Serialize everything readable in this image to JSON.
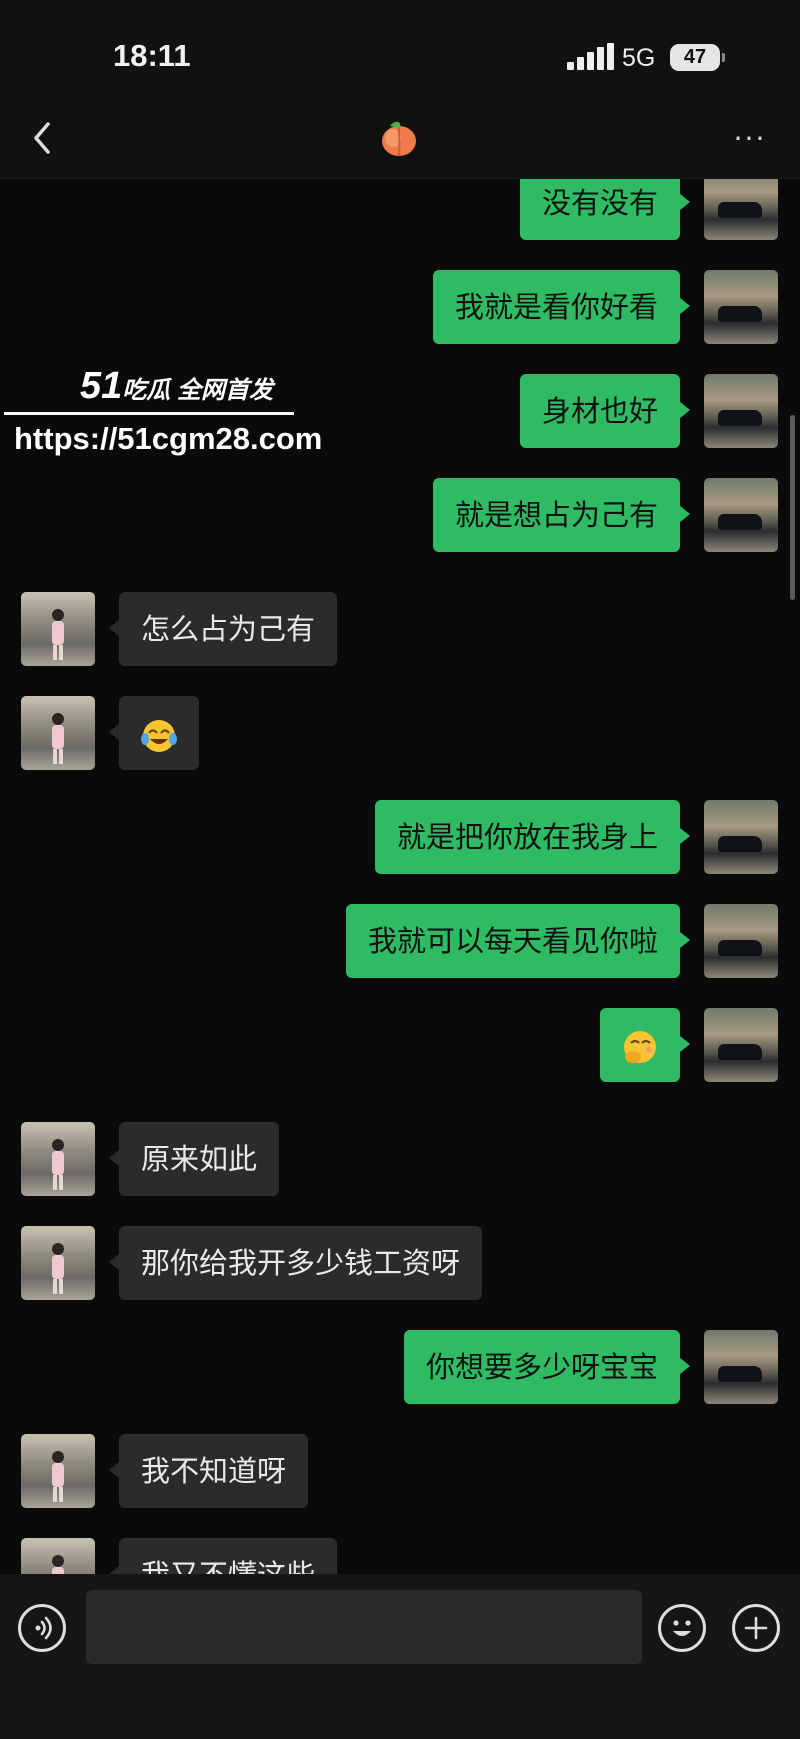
{
  "status": {
    "time": "18:11",
    "network": "5G",
    "battery": "47"
  },
  "header": {
    "title_icon": "peach-emoji-icon",
    "back_icon": "chevron-left-icon",
    "more_label": "···"
  },
  "watermark": {
    "brand": "51",
    "brand_text": "吃瓜 全网首发",
    "url": "https://51cgm28.com"
  },
  "messages": [
    {
      "from": "me",
      "text": "没有没有"
    },
    {
      "from": "me",
      "text": "我就是看你好看"
    },
    {
      "from": "me",
      "text": "身材也好"
    },
    {
      "from": "me",
      "text": "就是想占为己有"
    },
    {
      "from": "her",
      "text": "怎么占为己有"
    },
    {
      "from": "her",
      "emoji": "laughing-crying-emoji"
    },
    {
      "from": "me",
      "text": "就是把你放在我身上"
    },
    {
      "from": "me",
      "text": "我就可以每天看见你啦"
    },
    {
      "from": "me",
      "emoji": "shy-hand-over-mouth-emoji"
    },
    {
      "from": "her",
      "text": "原来如此"
    },
    {
      "from": "her",
      "text": "那你给我开多少钱工资呀"
    },
    {
      "from": "me",
      "text": "你想要多少呀宝宝"
    },
    {
      "from": "her",
      "text": "我不知道呀"
    },
    {
      "from": "her",
      "text": "我又不懂这些"
    }
  ],
  "input": {
    "placeholder": ""
  },
  "colors": {
    "bg": "#0a0a0a",
    "me_bubble": "#2fbb63",
    "her_bubble": "#2b2b2b"
  }
}
